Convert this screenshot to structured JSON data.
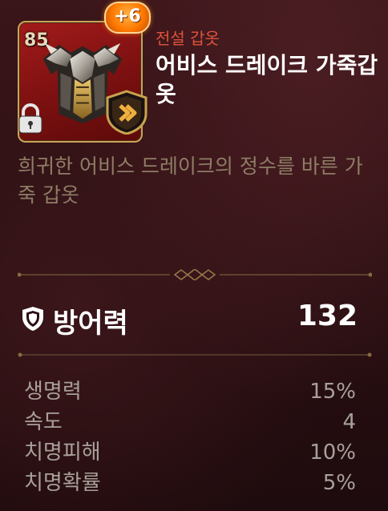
{
  "item": {
    "level": "85",
    "enhance": "+6",
    "grade": "전설 갑옷",
    "name": "어비스 드레이크 가죽갑옷",
    "description": "희귀한 어비스 드레이크의 정수를 바른 가죽 갑옷",
    "locked": true,
    "icons": {
      "armor": "dragon-armor-icon",
      "lock": "lock-icon",
      "class": "class-chevron-icon",
      "defense": "shield-icon"
    }
  },
  "main_stat": {
    "label": "방어력",
    "value": "132"
  },
  "stats": [
    {
      "label": "생명력",
      "value": "15%"
    },
    {
      "label": "속도",
      "value": "4"
    },
    {
      "label": "치명피해",
      "value": "10%"
    },
    {
      "label": "치명확률",
      "value": "5%"
    }
  ],
  "colors": {
    "grade": "#e0533b",
    "description": "#8e7d66",
    "stat_text": "#a8a09a",
    "frame_gold": "#c7a35a",
    "card_red": "#a31b1b"
  }
}
